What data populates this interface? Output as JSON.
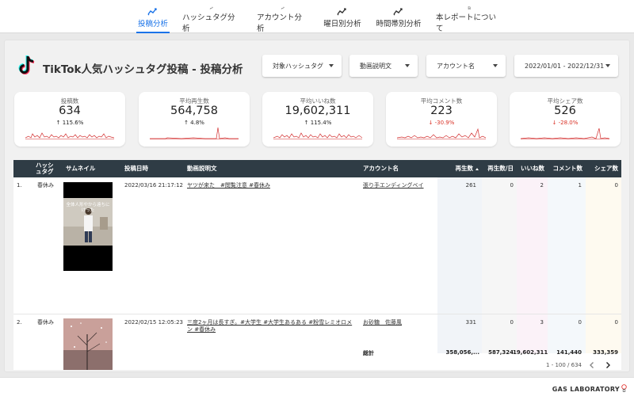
{
  "nav": {
    "tabs": [
      {
        "label": "投稿分析",
        "icon": "trend-icon",
        "active": true
      },
      {
        "label": "ハッシュタグ分析",
        "icon": "trend-icon",
        "active": false
      },
      {
        "label": "アカウント分析",
        "icon": "trend-icon",
        "active": false
      },
      {
        "label": "曜日別分析",
        "icon": "trend-icon",
        "active": false
      },
      {
        "label": "時間帯別分析",
        "icon": "trend-icon",
        "active": false
      },
      {
        "label": "本レポートについて",
        "icon": "document-icon",
        "active": false
      }
    ]
  },
  "header": {
    "logo_icon": "tiktok-logo-icon",
    "title": "TikTok人気ハッシュタグ投稿 - 投稿分析"
  },
  "filters": [
    {
      "label": "対象ハッシュタグ"
    },
    {
      "label": "動画説明文"
    },
    {
      "label": "アカウント名"
    },
    {
      "label": "2022/01/01 - 2022/12/31"
    }
  ],
  "kpis": [
    {
      "label": "投稿数",
      "value": "634",
      "delta": "↑ 115.6%",
      "direction": "up"
    },
    {
      "label": "平均再生数",
      "value": "564,758",
      "delta": "↑ 4.8%",
      "direction": "up"
    },
    {
      "label": "平均いいね数",
      "value": "19,602,311",
      "delta": "↑ 115.4%",
      "direction": "up"
    },
    {
      "label": "平均コメント数",
      "value": "223",
      "delta": "↓ -30.9%",
      "direction": "down"
    },
    {
      "label": "平均シェア数",
      "value": "526",
      "delta": "↓ -28.0%",
      "direction": "down"
    }
  ],
  "table": {
    "headers": {
      "hashtag": "ハッシュタグ",
      "thumbnail": "サムネイル",
      "posted_at": "投稿日時",
      "description": "動画説明文",
      "account": "アカウント名",
      "views": "再生数",
      "views_per_day": "再生数/日",
      "likes": "いいね数",
      "comments": "コメント数",
      "shares": "シェア数"
    },
    "rows": [
      {
        "index": "1.",
        "hashtag": "春休み",
        "thumbnail_caption": "全体人形やから遠ちにけった",
        "posted_at": "2022/03/16 21:17:12",
        "description": "ヤツが来た　#閲覧注意 #春休み",
        "account": "張り手エンディングベイ",
        "views": "261",
        "views_per_day": "0",
        "likes": "2",
        "comments": "1",
        "shares": "0"
      },
      {
        "index": "2.",
        "hashtag": "春休み",
        "thumbnail_caption": "",
        "posted_at": "2022/02/15 12:05:23",
        "description": "三度2ヶ月は長すぎ。#大学生 #大学生あるある #粉雪レミオロメン #春休み",
        "account": "お砂糖　佐藤風",
        "views": "331",
        "views_per_day": "0",
        "likes": "3",
        "comments": "0",
        "shares": "0"
      }
    ],
    "totals": {
      "label": "総計",
      "views": "358,056,...",
      "views_per_day": "587,324",
      "likes": "19,602,311",
      "comments": "141,440",
      "shares": "333,359"
    },
    "pagination": "1 - 100 / 634"
  },
  "footer": {
    "brand": "GAS LABORATORY"
  },
  "colors": {
    "accent": "#1a73e8",
    "table_header": "#2f3c45",
    "sparkline": "#d32f2f",
    "negative": "#d93025"
  }
}
